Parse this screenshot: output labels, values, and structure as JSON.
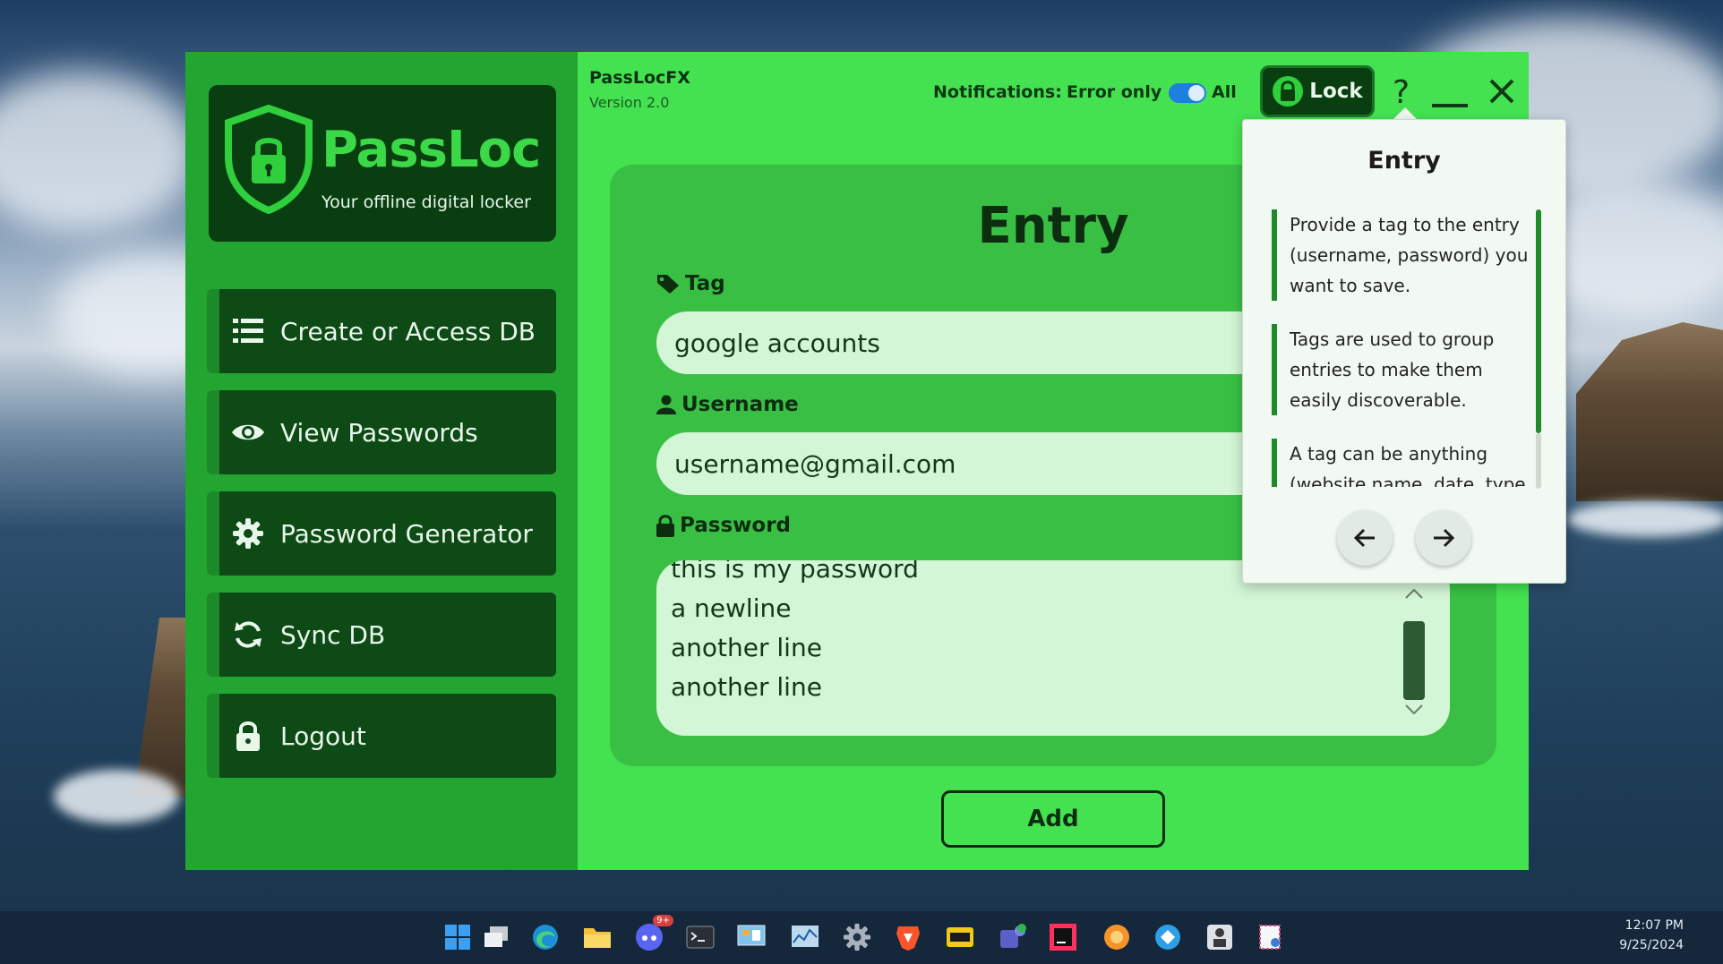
{
  "app": {
    "name": "PassLocFX",
    "version": "Version 2.0"
  },
  "logo": {
    "title": "PassLoc",
    "subtitle": "Your offline digital locker"
  },
  "sidebar": {
    "items": [
      {
        "label": "Create or Access DB",
        "icon": "database-icon"
      },
      {
        "label": "View Passwords",
        "icon": "eye-icon"
      },
      {
        "label": "Password Generator",
        "icon": "gear-icon"
      },
      {
        "label": "Sync DB",
        "icon": "sync-icon"
      },
      {
        "label": "Logout",
        "icon": "lock-icon"
      }
    ]
  },
  "topbar": {
    "notifications_label": "Notifications:",
    "option_error_only": "Error only",
    "option_all": "All",
    "toggle_state": "All",
    "lock_label": "Lock",
    "help_label": "?"
  },
  "form": {
    "heading": "Entry",
    "tag_label": "Tag",
    "tag_value": "google accounts",
    "username_label": "Username",
    "username_value": "username@gmail.com",
    "password_label": "Password",
    "password_lines": [
      "this is my password",
      "a newline",
      "another line",
      "another line"
    ],
    "add_label": "Add"
  },
  "help_popup": {
    "title": "Entry",
    "paragraphs": [
      "Provide a tag to the entry (username, password) you want to save.",
      "Tags are used to group entries to make them easily discoverable.",
      "A tag can be anything (website name, date, type"
    ]
  },
  "taskbar": {
    "time": "12:07 PM",
    "date": "9/25/2024",
    "discord_badge": "9+"
  },
  "colors": {
    "app_bg": "#44e251",
    "sidebar_bg": "#23a631",
    "nav_item_bg": "#0d4a16",
    "accent_dark": "#093f10",
    "input_bg": "#d3f6d6",
    "toggle_on": "#1d7fe0"
  }
}
